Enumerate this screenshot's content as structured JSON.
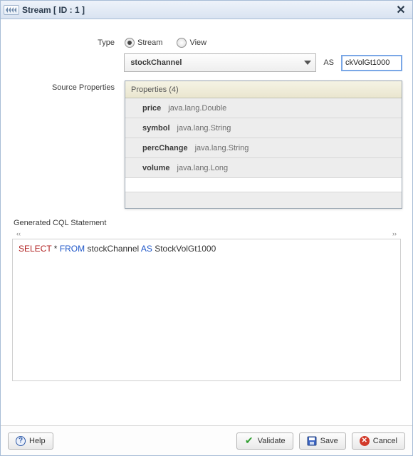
{
  "window": {
    "title": "Stream [ ID : 1 ]"
  },
  "form": {
    "type_label": "Type",
    "radios": {
      "stream": "Stream",
      "view": "View"
    },
    "selected_type": "stream",
    "source": {
      "value": "stockChannel",
      "as_label": "AS",
      "alias": "ckVolGt1000"
    }
  },
  "source_props": {
    "label": "Source Properties",
    "header": "Properties (4)",
    "rows": [
      {
        "name": "price",
        "type": "java.lang.Double"
      },
      {
        "name": "symbol",
        "type": "java.lang.String"
      },
      {
        "name": "percChange",
        "type": "java.lang.String"
      },
      {
        "name": "volume",
        "type": "java.lang.Long"
      }
    ]
  },
  "cql": {
    "label": "Generated CQL Statement",
    "count_hint": "",
    "select_kw": "SELECT",
    "star": " * ",
    "from_kw": "FROM",
    "table": " stockChannel ",
    "as_kw": "AS",
    "alias": " StockVolGt1000"
  },
  "footer": {
    "help": "Help",
    "validate": "Validate",
    "save": "Save",
    "cancel": "Cancel"
  }
}
